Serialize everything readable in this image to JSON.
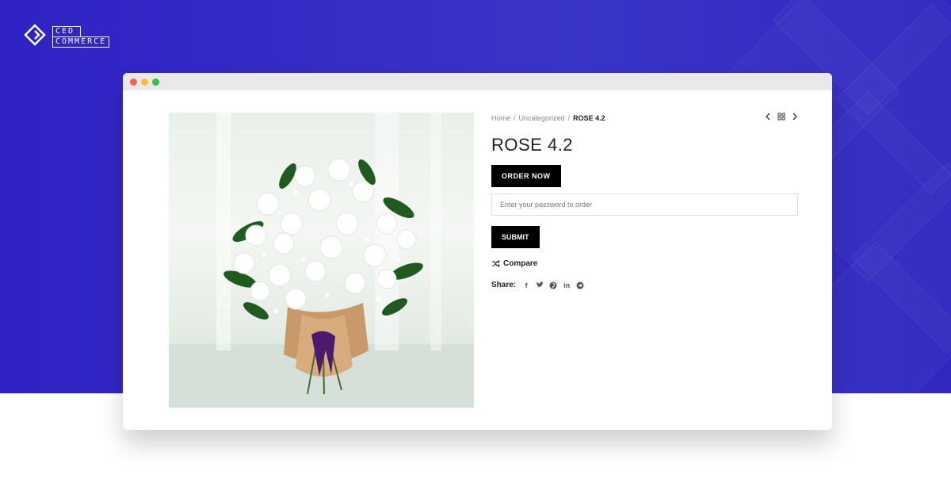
{
  "brand": {
    "logo_line1": "CED",
    "logo_line2": "COMMERCE"
  },
  "breadcrumb": {
    "home": "Home",
    "sep": "/",
    "category": "Uncategorized",
    "current": "ROSE 4.2"
  },
  "product": {
    "title": "ROSE 4.2",
    "order_label": "ORDER NOW",
    "password_placeholder": "Enter your password to order",
    "submit_label": "SUBMIT",
    "compare_label": "Compare",
    "share_label": "Share:"
  },
  "share_icons": [
    "facebook-icon",
    "twitter-icon",
    "pinterest-icon",
    "linkedin-icon",
    "telegram-icon"
  ],
  "colors": {
    "hero": "#3a35c9",
    "button": "#000000"
  }
}
